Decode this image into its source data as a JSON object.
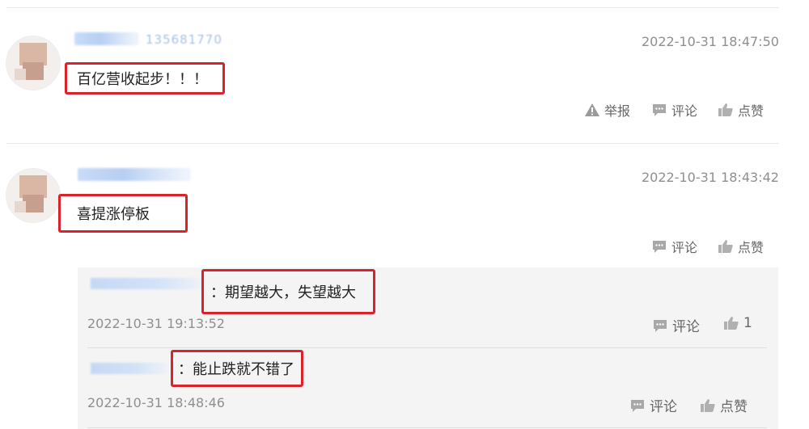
{
  "comments": [
    {
      "username": "135681770",
      "timestamp": "2022-10-31 18:47:50",
      "text": "百亿营收起步！！！",
      "actions": {
        "report": "举报",
        "comment": "评论",
        "like": "点赞"
      }
    },
    {
      "username": "",
      "timestamp": "2022-10-31 18:43:42",
      "text": "喜提涨停板",
      "actions": {
        "comment": "评论",
        "like": "点赞"
      },
      "replies": [
        {
          "text": "：期望越大，失望越大",
          "timestamp": "2022-10-31 19:13:52",
          "actions": {
            "comment": "评论",
            "like": "1"
          }
        },
        {
          "text": "：能止跌就不错了",
          "timestamp": "2022-10-31 18:48:46",
          "actions": {
            "comment": "评论",
            "like": "点赞"
          }
        }
      ]
    }
  ],
  "colors": {
    "highlight_border": "#d9222a",
    "reply_background": "#f4f4f4",
    "timestamp": "#8f8f8f",
    "link_blue": "#a7c0e6"
  },
  "icons": {
    "report": "warning-triangle-icon",
    "comment": "speech-bubble-icon",
    "like": "thumbs-up-icon"
  }
}
